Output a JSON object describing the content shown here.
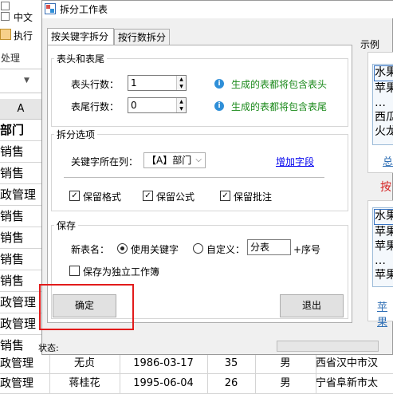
{
  "sheet": {
    "checkbox_items": [
      "",
      "中文",
      "执行"
    ],
    "toolbar_label": "处理",
    "column_letter": "A",
    "column_cells": [
      "部门",
      "销售",
      "销售",
      "政管理",
      "销售",
      "销售",
      "销售",
      "销售",
      "政管理",
      "政管理",
      "销售"
    ],
    "bottom_rows": [
      [
        "政管理",
        "无贞",
        "1986-03-17",
        "35",
        "男",
        "西省汉中市汉"
      ],
      [
        "政管理",
        "蒋桂花",
        "1995-06-04",
        "26",
        "男",
        "宁省阜新市太"
      ]
    ]
  },
  "dialog": {
    "title": "拆分工作表",
    "tabs": [
      "按关键字拆分",
      "按行数拆分"
    ],
    "header_footer": {
      "title": "表头和表尾",
      "header_rows_label": "表头行数：",
      "header_rows_value": "1",
      "header_hint": "生成的表都将包含表头",
      "footer_rows_label": "表尾行数：",
      "footer_rows_value": "0",
      "footer_hint": "生成的表都将包含表尾"
    },
    "split_options": {
      "title": "拆分选项",
      "key_column_label": "关键字所在列：",
      "key_column_value": "【A】部门",
      "add_field_link": "增加字段",
      "keep_format": "保留格式",
      "keep_formula": "保留公式",
      "keep_comment": "保留批注"
    },
    "save": {
      "title": "保存",
      "new_name_label": "新表名：",
      "use_keyword": "使用关键字",
      "custom": "自定义：",
      "custom_value": "分表",
      "suffix": "+序号",
      "save_independent": "保存为独立工作簿"
    },
    "ok_button": "确定",
    "exit_button": "退出",
    "status_label": "状态:"
  },
  "example": {
    "title": "示例",
    "box1_lines": [
      "水果",
      "苹果",
      "…",
      "西瓜",
      "火龙"
    ],
    "box1_tab": "总",
    "middle_label": "按",
    "box2_lines": [
      "水果",
      "苹果",
      "苹果",
      "…",
      "苹果"
    ],
    "box2_tab": "苹果"
  }
}
